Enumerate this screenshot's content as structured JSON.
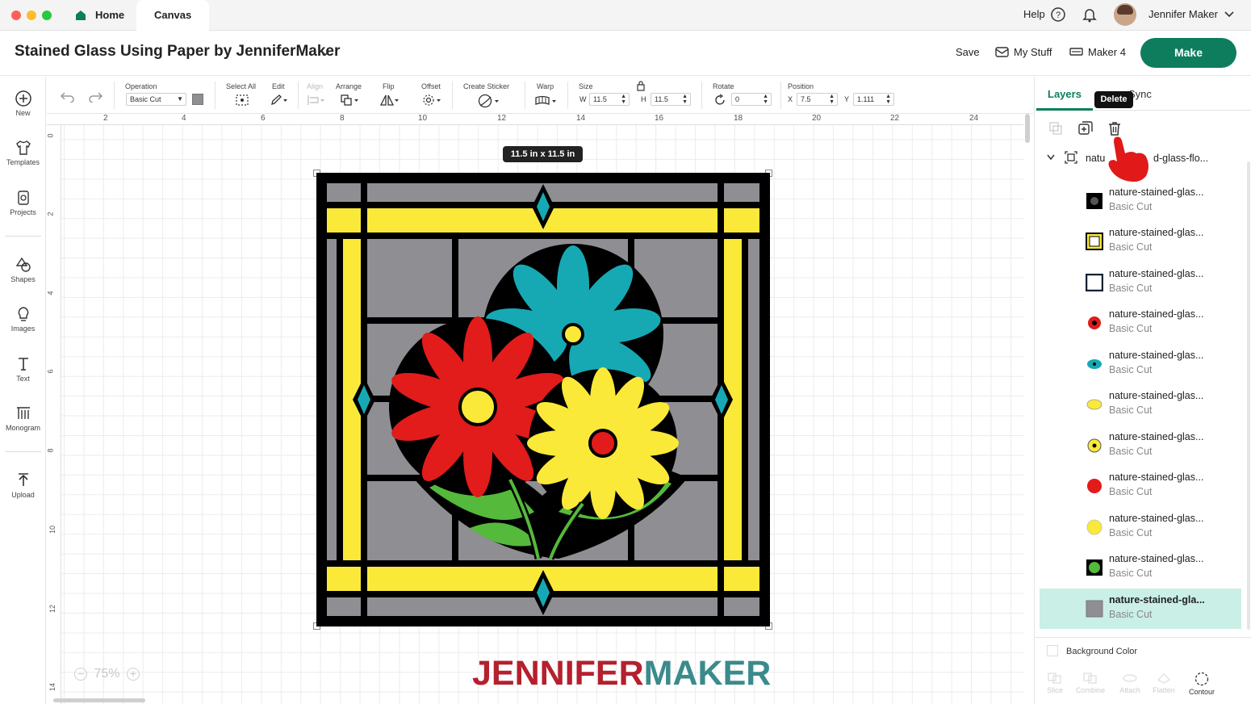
{
  "window": {
    "tabs": [
      {
        "label": "Home"
      },
      {
        "label": "Canvas"
      }
    ],
    "help_label": "Help",
    "user_name": "Jennifer Maker"
  },
  "project": {
    "title": "Stained Glass Using Paper by JenniferMaker",
    "save_label": "Save",
    "my_stuff_label": "My Stuff",
    "machine_label": "Maker 4",
    "make_label": "Make"
  },
  "left_toolbar": {
    "items": [
      {
        "label": "New",
        "icon": "plus-circle-icon"
      },
      {
        "label": "Templates",
        "icon": "shirt-icon"
      },
      {
        "label": "Projects",
        "icon": "projects-icon"
      },
      {
        "label": "Shapes",
        "icon": "shapes-icon"
      },
      {
        "label": "Images",
        "icon": "lightbulb-icon"
      },
      {
        "label": "Text",
        "icon": "text-icon"
      },
      {
        "label": "Monogram",
        "icon": "monogram-icon"
      },
      {
        "label": "Upload",
        "icon": "upload-icon"
      }
    ]
  },
  "edit_toolbar": {
    "operation_label": "Operation",
    "operation_value": "Basic Cut",
    "select_all_label": "Select All",
    "edit_label": "Edit",
    "align_label": "Align",
    "arrange_label": "Arrange",
    "flip_label": "Flip",
    "offset_label": "Offset",
    "create_sticker_label": "Create Sticker",
    "warp_label": "Warp",
    "size_label": "Size",
    "width_prefix": "W",
    "width_value": "11.5",
    "height_prefix": "H",
    "height_value": "11.5",
    "rotate_label": "Rotate",
    "rotate_value": "0",
    "position_label": "Position",
    "x_prefix": "X",
    "x_value": "7.5",
    "y_prefix": "Y",
    "y_value": "1.111"
  },
  "canvas": {
    "ruler_top": [
      "2",
      "4",
      "6",
      "8",
      "10",
      "12",
      "14",
      "16",
      "18",
      "20",
      "22",
      "24"
    ],
    "ruler_left": [
      "0",
      "2",
      "4",
      "6",
      "8",
      "10",
      "12",
      "14"
    ],
    "size_badge": "11.5  in x 11.5  in",
    "zoom_label": "75%",
    "brand_part1": "JENNIFER",
    "brand_part2": "MAKER",
    "colors": {
      "black": "#000000",
      "gray": "#8e8e93",
      "yellow": "#fbe93a",
      "teal": "#16a9b4",
      "red": "#e21b1b",
      "green": "#55b93c",
      "brand_red": "#b5202e",
      "brand_teal": "#3b8a8c"
    }
  },
  "layers_panel": {
    "tab_layers": "Layers",
    "tab_sync": "Sync",
    "tooltip": "Delete",
    "group_name": "natu",
    "group_name_tail": "d-glass-flo...",
    "layers": [
      {
        "name": "nature-stained-glas...",
        "op": "Basic Cut",
        "thumb": "black-frame"
      },
      {
        "name": "nature-stained-glas...",
        "op": "Basic Cut",
        "thumb": "yellow-square"
      },
      {
        "name": "nature-stained-glas...",
        "op": "Basic Cut",
        "thumb": "teal-square"
      },
      {
        "name": "nature-stained-glas...",
        "op": "Basic Cut",
        "thumb": "red-flower"
      },
      {
        "name": "nature-stained-glas...",
        "op": "Basic Cut",
        "thumb": "teal-flower"
      },
      {
        "name": "nature-stained-glas...",
        "op": "Basic Cut",
        "thumb": "yellow-flower"
      },
      {
        "name": "nature-stained-glas...",
        "op": "Basic Cut",
        "thumb": "yellow-flower-center"
      },
      {
        "name": "nature-stained-glas...",
        "op": "Basic Cut",
        "thumb": "red-blob"
      },
      {
        "name": "nature-stained-glas...",
        "op": "Basic Cut",
        "thumb": "yellow-blob"
      },
      {
        "name": "nature-stained-glas...",
        "op": "Basic Cut",
        "thumb": "green-leaves"
      },
      {
        "name": "nature-stained-gla...",
        "op": "Basic Cut",
        "thumb": "gray-square",
        "selected": true
      }
    ],
    "background_color_label": "Background Color",
    "bottom_tools": [
      {
        "label": "Slice"
      },
      {
        "label": "Combine"
      },
      {
        "label": "Attach"
      },
      {
        "label": "Flatten"
      },
      {
        "label": "Contour"
      }
    ]
  }
}
